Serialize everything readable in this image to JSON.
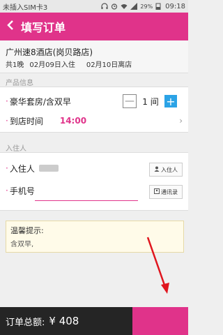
{
  "status": {
    "carrier": "未插入SIM卡3",
    "battery": "29%",
    "time": "09:18"
  },
  "header": {
    "title": "填写订单"
  },
  "hotel": {
    "name": "广州速8酒店(岗贝路店)",
    "nights": "共1晚",
    "checkin": "02月09日入住",
    "checkout": "02月10日离店"
  },
  "product": {
    "section_label": "产品信息",
    "room_type": "豪华套房/含双早",
    "room_count": "1",
    "room_unit": "间",
    "minus": "—",
    "plus": "+",
    "arrival_label": "到店时间",
    "arrival_time": "14:00"
  },
  "guest": {
    "section_label": "入住人",
    "name_label": "入住人",
    "phone_label": "手机号",
    "guest_button": "入住人",
    "contacts_button": "通讯录"
  },
  "notice": {
    "title": "温馨提示:",
    "detail": "含双早,"
  },
  "footer": {
    "total_label": "订单总额:",
    "currency": "¥",
    "amount": "408"
  },
  "colors": {
    "accent": "#e0338a",
    "plus_button": "#2ba3e6",
    "footer_bg": "#252525",
    "annotation_arrow": "#e0151e"
  }
}
